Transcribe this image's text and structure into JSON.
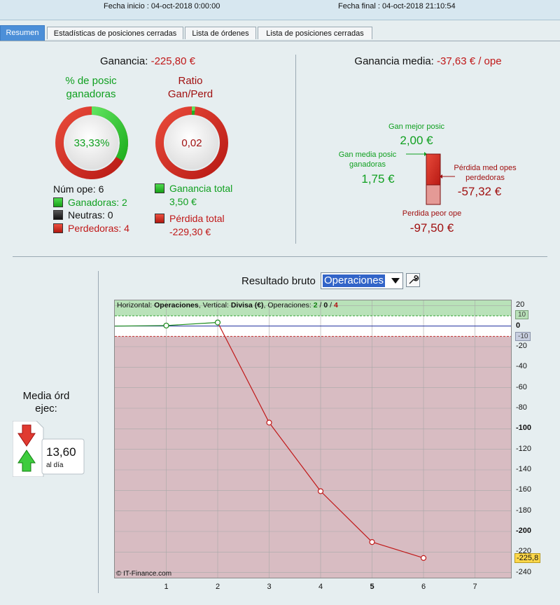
{
  "header": {
    "start": "Fecha inicio :  04-oct-2018 0:00:00",
    "end": "Fecha final :  04-oct-2018 21:10:54"
  },
  "tabs": [
    "Resumen",
    "Estadísticas de posiciones cerradas",
    "Lista de órdenes",
    "Lista de posiciones cerradas"
  ],
  "summary": {
    "profit_label": "Ganancia:",
    "profit_value": "-225,80 €",
    "win_pct_title1": "% de posic",
    "win_pct_title2": "ganadoras",
    "win_pct_value": "33,33%",
    "win_fraction": 0.3333,
    "ratio_title1": "Ratio",
    "ratio_title2": "Gan/Perd",
    "ratio_value": "0,02",
    "ratio_fraction": 0.015,
    "num_ops": "Núm ope: 6",
    "winners": "Ganadoras: 2",
    "neutrals": "Neutras: 0",
    "losers": "Perdedoras: 4",
    "total_gain_label": "Ganancia total",
    "total_gain_value": "3,50 €",
    "total_loss_label": "Pérdida total",
    "total_loss_value": "-229,30 €"
  },
  "avg": {
    "label": "Ganancia media:",
    "value": "-37,63 € / ope",
    "best_label": "Gan mejor posic",
    "best_value": "2,00 €",
    "avg_win_label1": "Gan media posic",
    "avg_win_label2": "ganadoras",
    "avg_win_value": "1,75 €",
    "avg_loss_label1": "Pérdida med opes",
    "avg_loss_label2": "perdedoras",
    "avg_loss_value": "-57,32 €",
    "worst_label": "Perdida peor ope",
    "worst_value": "-97,50 €"
  },
  "side": {
    "label1": "Media órd",
    "label2": "ejec:",
    "value": "13,60",
    "unit": "al día"
  },
  "chart_header": {
    "label": "Resultado bruto",
    "select": "Operaciones"
  },
  "chart_info": {
    "prefix": "Horizontal: ",
    "h": "Operaciones",
    "mid": ", Vertical: ",
    "v": "Divisa (€)",
    "ops": ", Operaciones: ",
    "w": "2",
    "sep1": " / ",
    "n": "0",
    "sep2": " / ",
    "l": "4"
  },
  "copyright": "© IT-Finance.com",
  "colors": {
    "win": "#1ec81e",
    "loss": "#d42a2a",
    "accent": "#4c8fd8"
  },
  "chart_data": {
    "type": "line",
    "x": [
      0,
      1,
      2,
      3,
      4,
      5,
      6
    ],
    "y": [
      0,
      0.5,
      3.5,
      -94,
      -160.8,
      -210.3,
      -225.8
    ],
    "xlim": [
      0,
      7.7
    ],
    "ylim": [
      -245,
      25
    ],
    "xticks": [
      1,
      2,
      3,
      4,
      5,
      6,
      7
    ],
    "yticks": [
      20,
      0,
      -20,
      -40,
      -60,
      -80,
      -100,
      -120,
      -140,
      -160,
      -180,
      -200,
      -220,
      -240
    ],
    "bold_yticks": [
      0,
      -100,
      -200
    ],
    "thresholds": {
      "upper": 10,
      "lower": -10
    },
    "upper_badge": "10",
    "lower_badge": "-10",
    "last_badge": "-225,8",
    "grid": true
  }
}
